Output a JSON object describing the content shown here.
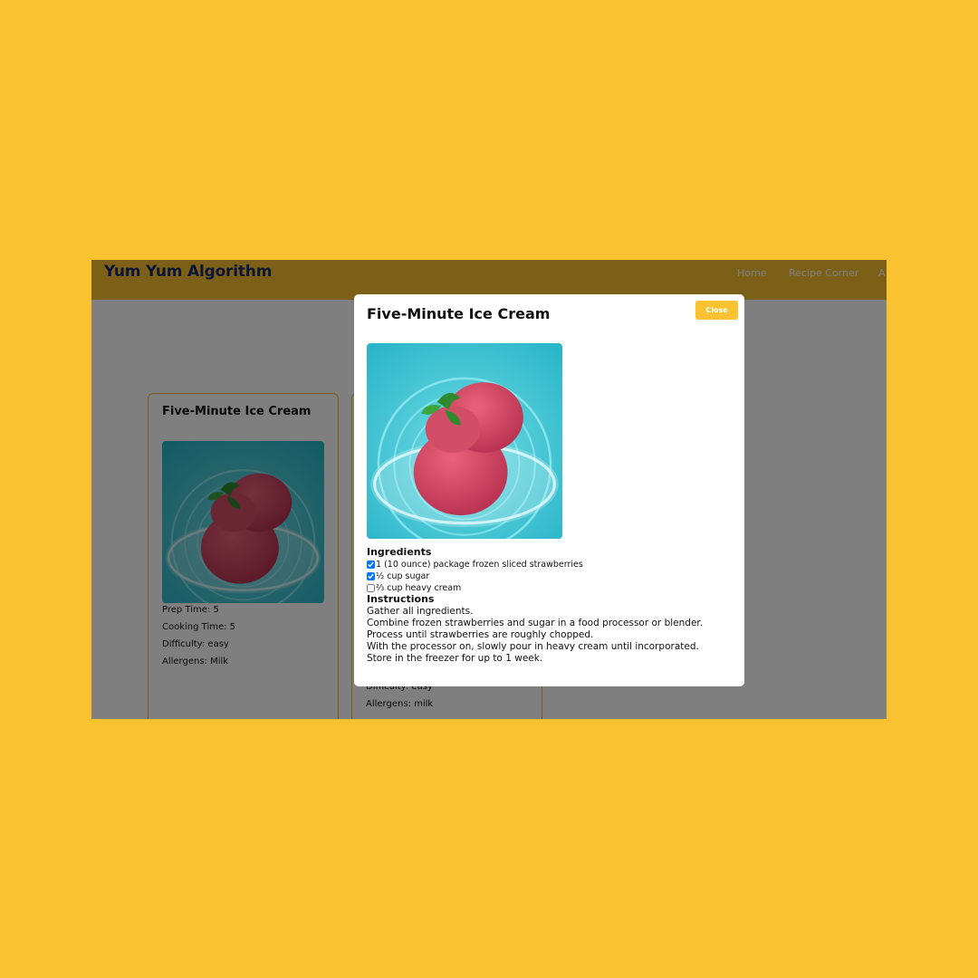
{
  "site": {
    "brand": "Yum Yum Algorithm",
    "nav": [
      {
        "label": "Home"
      },
      {
        "label": "Recipe Corner"
      },
      {
        "label": "A"
      }
    ]
  },
  "cards": [
    {
      "title": "Five-Minute Ice Cream",
      "image_label": "strawberry ice cream in glass bowl",
      "meta": [
        "Prep Time: 5",
        "Cooking Time: 5",
        "Difficulty: easy",
        "Allergens: Milk"
      ]
    },
    {
      "meta_visible": [
        "Difficulty: easy",
        "Allergens: milk"
      ]
    }
  ],
  "modal": {
    "title": "Five-Minute Ice Cream",
    "close_label": "Close",
    "image_label": "strawberry ice cream in glass bowl",
    "ingredients_heading": "Ingredients",
    "ingredients": [
      {
        "text": "1 (10 ounce) package frozen sliced strawberries",
        "checked": true
      },
      {
        "text": "½ cup sugar",
        "checked": true
      },
      {
        "text": "⅔ cup heavy cream",
        "checked": false
      }
    ],
    "instructions_heading": "Instructions",
    "instructions": [
      "Gather all ingredients.",
      "Combine frozen strawberries and sugar in a food processor or blender. Process until strawberries are roughly chopped.",
      "With the processor on, slowly pour in heavy cream until incorporated.",
      "Store in the freezer for up to 1 week."
    ]
  },
  "colors": {
    "background": "#fac130",
    "brand_text": "#1b2a6b",
    "card_border": "#f2b933",
    "overlay": "rgba(0,0,0,0.5)"
  }
}
